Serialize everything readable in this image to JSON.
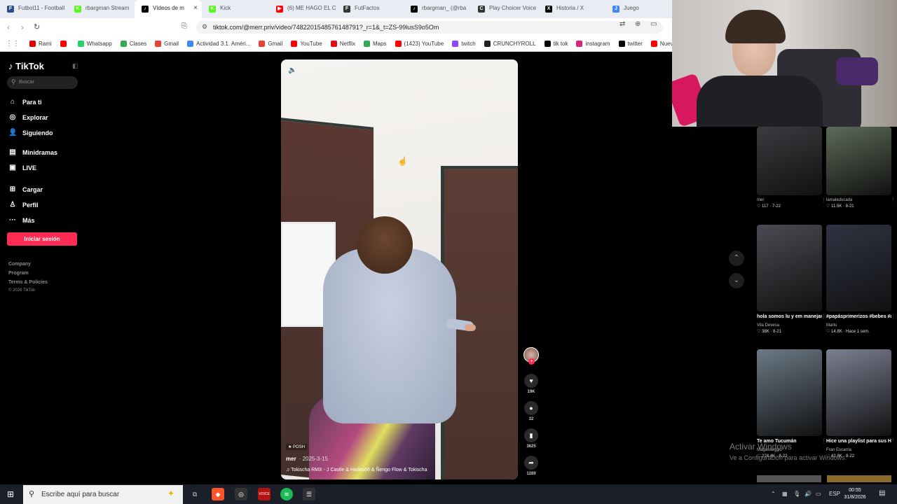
{
  "browser": {
    "tabs": [
      {
        "label": "Futbol11 - Football",
        "color": "#2c4a8c",
        "glyph": "F"
      },
      {
        "label": "rbargman Stream",
        "color": "#53fc18",
        "glyph": "K"
      },
      {
        "label": "Vídeos de m",
        "color": "#000000",
        "glyph": "♪",
        "active": true
      },
      {
        "label": "Kick",
        "color": "#53fc18",
        "glyph": "K"
      },
      {
        "label": "(6) ME HAGO EL CO",
        "color": "#ff0000",
        "glyph": "▶"
      },
      {
        "label": "FutFactos",
        "color": "#333333",
        "glyph": "F"
      },
      {
        "label": "rbargman_ (@rba",
        "color": "#000000",
        "glyph": "♪"
      },
      {
        "label": "Play Choicer Voice",
        "color": "#333333",
        "glyph": "C"
      },
      {
        "label": "Historia / X",
        "color": "#000000",
        "glyph": "X"
      },
      {
        "label": "Juego",
        "color": "#4285f4",
        "glyph": "J"
      }
    ],
    "url": "tiktok.com/@merr.priv/video/7482201548576148791?_r=1&_t=ZS-99lusS9o5Om",
    "bookmarks": [
      {
        "label": "Rami",
        "color": "#e00000"
      },
      {
        "label": "",
        "color": "#ff0000"
      },
      {
        "label": "Whatsapp",
        "color": "#25d366"
      },
      {
        "label": "Clases",
        "color": "#34a853"
      },
      {
        "label": "Gmail",
        "color": "#ea4335"
      },
      {
        "label": "Actividad 3.1. Améri...",
        "color": "#4285f4"
      },
      {
        "label": "Gmail",
        "color": "#ea4335"
      },
      {
        "label": "YouTube",
        "color": "#ff0000"
      },
      {
        "label": "Netflix",
        "color": "#e50914"
      },
      {
        "label": "Maps",
        "color": "#34a853"
      },
      {
        "label": "(1423) YouTube",
        "color": "#ff0000"
      },
      {
        "label": "twitch",
        "color": "#9146ff"
      },
      {
        "label": "CRUNCHYROLL",
        "color": "#222222"
      },
      {
        "label": "tik tok",
        "color": "#000000"
      },
      {
        "label": "instagram",
        "color": "#d62976"
      },
      {
        "label": "twitter",
        "color": "#000000"
      },
      {
        "label": "Nueva",
        "color": "#ff0000"
      }
    ]
  },
  "sidebar": {
    "logo": "TikTok",
    "search_placeholder": "Buscar",
    "nav": [
      {
        "label": "Para ti",
        "icon": "⌂",
        "name": "home"
      },
      {
        "label": "Explorar",
        "icon": "◎",
        "name": "explore"
      },
      {
        "label": "Siguiendo",
        "icon": "👤",
        "name": "following"
      },
      {
        "label": "Minidramas",
        "icon": "▤",
        "name": "minidramas"
      },
      {
        "label": "LIVE",
        "icon": "▣",
        "name": "live"
      },
      {
        "label": "Cargar",
        "icon": "⊞",
        "name": "upload"
      },
      {
        "label": "Perfil",
        "icon": "♙",
        "name": "profile"
      },
      {
        "label": "Más",
        "icon": "···",
        "name": "more"
      }
    ],
    "login_label": "Iniciar sesión",
    "footer": [
      "Company",
      "Program",
      "Terms & Policies",
      "© 2026 TikTok"
    ]
  },
  "video": {
    "badge": "POSH",
    "author": "mer",
    "date": "· 2025-3-15",
    "music": "♫ Tokischa RMX - J Castle & Hades66 & Ñengo Flow & Tokischa",
    "likes": "19K",
    "comments": "32",
    "saves": "3625",
    "shares": "1289"
  },
  "recommended": [
    {
      "title": "",
      "author": "mer",
      "stats": "♡ 117 · 7-22",
      "bg": "#3b3b40"
    },
    {
      "title": "",
      "author": "lamaleducada",
      "stats": "♡ 11.5K · 8-21",
      "bg": "#5d6b58"
    },
    {
      "title": "hola somos lu y em manejando la cuenta...",
      "author": "Vila Devesa",
      "stats": "♡ 38K · 8-21",
      "bg": "#4a4a52"
    },
    {
      "title": "#papásprimerizos #bebes #argentina...",
      "author": "Martu",
      "stats": "♡ 14.8K · Hace 1 sem.",
      "bg": "#2e3442"
    },
    {
      "title": "Te amo Tucumán",
      "author": "Magasseggio",
      "stats": "♡ 224.4K · 8-22",
      "bg": "#6b7a86"
    },
    {
      "title": "Hice una playlist para sus HOT GIRL WALK's ...",
      "author": "Fran Escarria",
      "stats": "♡ 42.8K · 8-22",
      "bg": "#7b8092"
    }
  ],
  "windows": {
    "activate_line1": "Activar Windows",
    "activate_line2": "Ve a Configuración para activar Windows.",
    "search_placeholder": "Escribe aquí para buscar",
    "language": "ESP",
    "time": "00:55",
    "date": "31/8/2026"
  }
}
